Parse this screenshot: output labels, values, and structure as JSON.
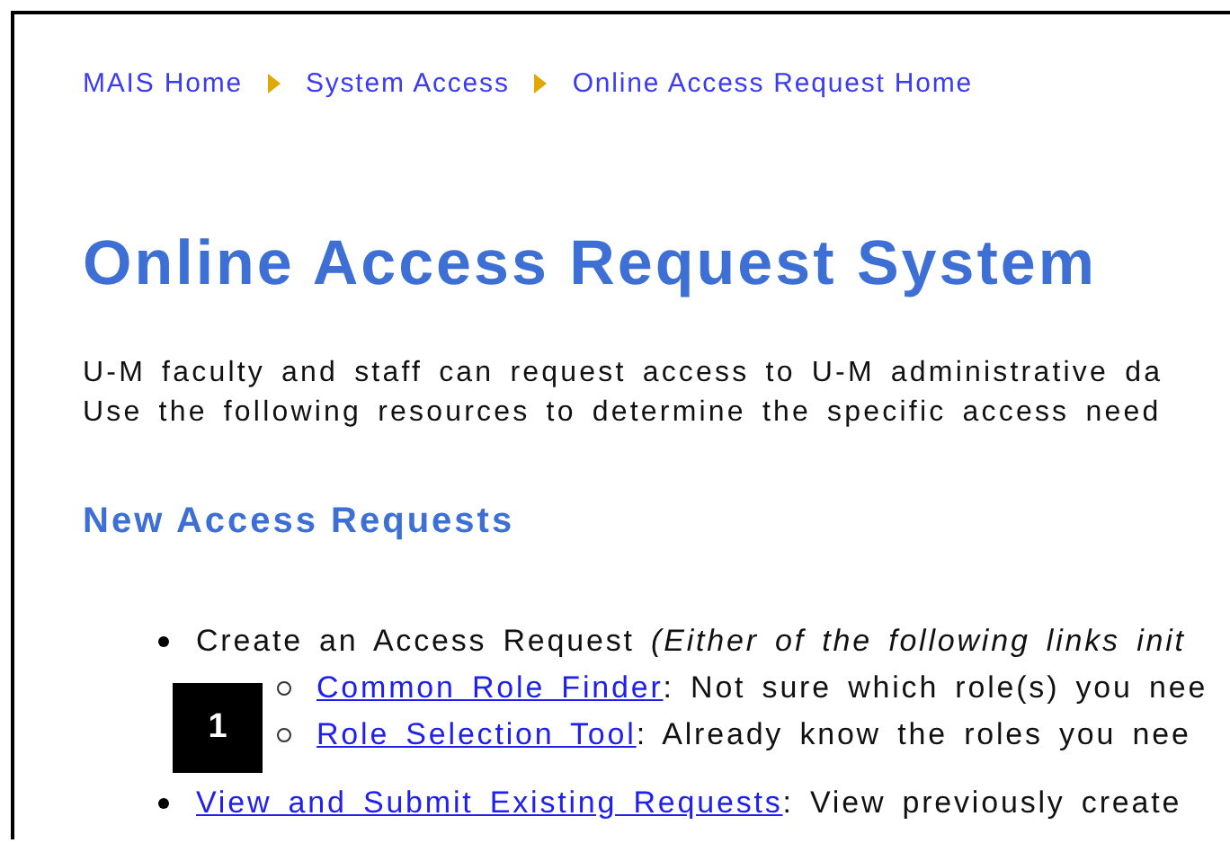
{
  "breadcrumb": [
    "MAIS Home",
    "System Access",
    "Online Access Request Home"
  ],
  "title": "Online Access Request System",
  "intro": [
    "U-M faculty and staff can request access to U-M administrative da",
    "Use the following resources to determine the specific access need"
  ],
  "section_heading": "New Access Requests",
  "items": [
    {
      "kind": "text",
      "text": "Create an Access Request *(Either of the following links init*",
      "children": [
        {
          "link": "Common Role Finder",
          "text": ": Not sure which role(s) you nee"
        },
        {
          "link": "Role Selection Tool",
          "text": ": Already know the roles you nee"
        }
      ]
    },
    {
      "kind": "link",
      "link": "View and Submit Existing Requests",
      "text": ": View previously create"
    }
  ],
  "callout": "1"
}
